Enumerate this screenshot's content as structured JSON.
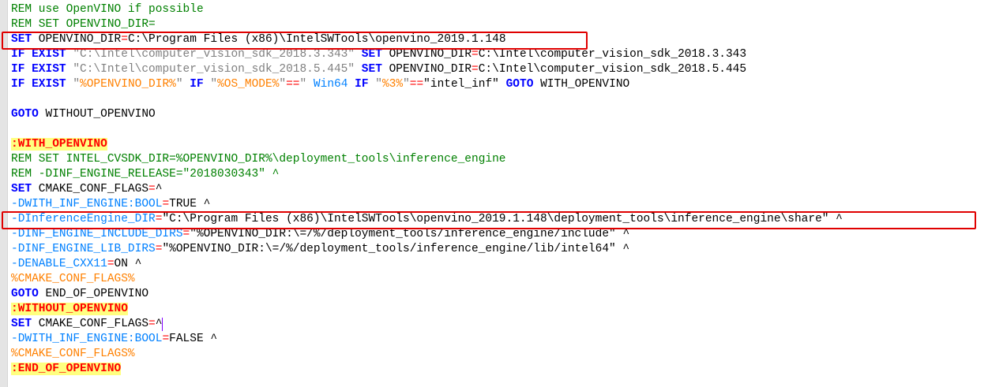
{
  "editor": {
    "lines": [
      {
        "parts": [
          {
            "c": "c",
            "t": "REM use OpenVINO if possible"
          }
        ]
      },
      {
        "parts": [
          {
            "c": "c",
            "t": "REM SET OPENVINO_DIR="
          }
        ]
      },
      {
        "parts": [
          {
            "c": "k",
            "t": "SET"
          },
          {
            "c": "t",
            "t": " OPENVINO_DIR"
          },
          {
            "c": "o",
            "t": "="
          },
          {
            "c": "t",
            "t": "C:\\Program Files (x86)\\IntelSWTools\\openvino_2019.1.148"
          }
        ]
      },
      {
        "parts": [
          {
            "c": "k",
            "t": "IF EXIST"
          },
          {
            "c": "t",
            "t": " "
          },
          {
            "c": "s",
            "t": "\"C:\\Intel\\computer_vision_sdk_2018.3.343\""
          },
          {
            "c": "t",
            "t": " "
          },
          {
            "c": "k",
            "t": "SET"
          },
          {
            "c": "t",
            "t": " OPENVINO_DIR"
          },
          {
            "c": "o",
            "t": "="
          },
          {
            "c": "t",
            "t": "C:\\Intel\\computer_vision_sdk_2018.3.343"
          }
        ]
      },
      {
        "parts": [
          {
            "c": "k",
            "t": "IF EXIST"
          },
          {
            "c": "t",
            "t": " "
          },
          {
            "c": "s",
            "t": "\"C:\\Intel\\computer_vision_sdk_2018.5.445\""
          },
          {
            "c": "t",
            "t": " "
          },
          {
            "c": "k",
            "t": "SET"
          },
          {
            "c": "t",
            "t": " OPENVINO_DIR"
          },
          {
            "c": "o",
            "t": "="
          },
          {
            "c": "t",
            "t": "C:\\Intel\\computer_vision_sdk_2018.5.445"
          }
        ]
      },
      {
        "parts": [
          {
            "c": "k",
            "t": "IF EXIST"
          },
          {
            "c": "t",
            "t": " "
          },
          {
            "c": "s",
            "t": "\""
          },
          {
            "c": "v",
            "t": "%OPENVINO_DIR%"
          },
          {
            "c": "s",
            "t": "\""
          },
          {
            "c": "t",
            "t": " "
          },
          {
            "c": "k",
            "t": "IF"
          },
          {
            "c": "t",
            "t": " "
          },
          {
            "c": "s",
            "t": "\""
          },
          {
            "c": "v",
            "t": "%OS_MODE%"
          },
          {
            "c": "s",
            "t": "\""
          },
          {
            "c": "o",
            "t": "=="
          },
          {
            "c": "s",
            "t": "\""
          },
          {
            "c": "t",
            "t": " "
          },
          {
            "c": "f",
            "t": "Win64"
          },
          {
            "c": "t",
            "t": " "
          },
          {
            "c": "k",
            "t": "IF"
          },
          {
            "c": "t",
            "t": " "
          },
          {
            "c": "s",
            "t": "\""
          },
          {
            "c": "v",
            "t": "%3%"
          },
          {
            "c": "s",
            "t": "\""
          },
          {
            "c": "o",
            "t": "=="
          },
          {
            "c": "t",
            "t": "\"intel_inf\" "
          },
          {
            "c": "k",
            "t": "GOTO"
          },
          {
            "c": "t",
            "t": " WITH_OPENVINO"
          }
        ]
      },
      {
        "parts": [
          {
            "c": "t",
            "t": ""
          }
        ]
      },
      {
        "parts": [
          {
            "c": "k",
            "t": "GOTO"
          },
          {
            "c": "t",
            "t": " WITHOUT_OPENVINO"
          }
        ]
      },
      {
        "parts": [
          {
            "c": "t",
            "t": ""
          }
        ]
      },
      {
        "parts": [
          {
            "c": "lb",
            "t": ":WITH_OPENVINO"
          }
        ]
      },
      {
        "parts": [
          {
            "c": "c",
            "t": "REM SET INTEL_CVSDK_DIR=%OPENVINO_DIR%\\deployment_tools\\inference_engine"
          }
        ]
      },
      {
        "parts": [
          {
            "c": "c",
            "t": "REM -DINF_ENGINE_RELEASE=\"2018030343\" ^"
          }
        ]
      },
      {
        "parts": [
          {
            "c": "k",
            "t": "SET"
          },
          {
            "c": "t",
            "t": " CMAKE_CONF_FLAGS"
          },
          {
            "c": "o",
            "t": "="
          },
          {
            "c": "t",
            "t": "^"
          }
        ]
      },
      {
        "parts": [
          {
            "c": "f",
            "t": "-DWITH_INF_ENGINE:BOOL"
          },
          {
            "c": "o",
            "t": "="
          },
          {
            "c": "t",
            "t": "TRUE ^"
          }
        ]
      },
      {
        "parts": [
          {
            "c": "f",
            "t": "-DInferenceEngine_DIR"
          },
          {
            "c": "o",
            "t": "="
          },
          {
            "c": "t",
            "t": "\"C:\\Program Files (x86)\\IntelSWTools\\openvino_2019.1.148\\deployment_tools\\inference_engine\\share\" ^"
          }
        ]
      },
      {
        "parts": [
          {
            "c": "f",
            "t": "-DINF_ENGINE_INCLUDE_DIRS"
          },
          {
            "c": "o",
            "t": "="
          },
          {
            "c": "t",
            "t": "\"%OPENVINO_DIR:\\=/%/deployment_tools/inference_engine/include\" ^"
          }
        ]
      },
      {
        "parts": [
          {
            "c": "f",
            "t": "-DINF_ENGINE_LIB_DIRS"
          },
          {
            "c": "o",
            "t": "="
          },
          {
            "c": "t",
            "t": "\"%OPENVINO_DIR:\\=/%/deployment_tools/inference_engine/lib/intel64\" ^"
          }
        ]
      },
      {
        "parts": [
          {
            "c": "f",
            "t": "-DENABLE_CXX11"
          },
          {
            "c": "o",
            "t": "="
          },
          {
            "c": "t",
            "t": "ON ^"
          }
        ]
      },
      {
        "parts": [
          {
            "c": "v",
            "t": "%CMAKE_CONF_FLAGS%"
          }
        ]
      },
      {
        "parts": [
          {
            "c": "k",
            "t": "GOTO"
          },
          {
            "c": "t",
            "t": " END_OF_OPENVINO"
          }
        ]
      },
      {
        "parts": [
          {
            "c": "lb",
            "t": ":WITHOUT_OPENVINO"
          }
        ]
      },
      {
        "current": true,
        "caret": true,
        "parts": [
          {
            "c": "k",
            "t": "SET"
          },
          {
            "c": "t",
            "t": " CMAKE_CONF_FLAGS"
          },
          {
            "c": "o",
            "t": "="
          },
          {
            "c": "t",
            "t": "^"
          }
        ]
      },
      {
        "parts": [
          {
            "c": "f",
            "t": "-DWITH_INF_ENGINE:BOOL"
          },
          {
            "c": "o",
            "t": "="
          },
          {
            "c": "t",
            "t": "FALSE ^"
          }
        ]
      },
      {
        "parts": [
          {
            "c": "v",
            "t": "%CMAKE_CONF_FLAGS%"
          }
        ]
      },
      {
        "parts": [
          {
            "c": "lb",
            "t": ":END_OF_OPENVINO"
          }
        ]
      }
    ],
    "highlight_color": "#e00000",
    "highlighted_lines": [
      3,
      15
    ]
  }
}
